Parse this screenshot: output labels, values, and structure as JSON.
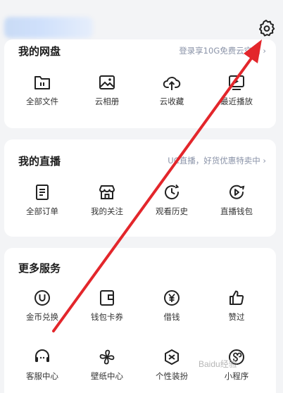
{
  "netdisk": {
    "title": "我的网盘",
    "hint": "登录享10G免费云空间 ›",
    "items": [
      {
        "label": "全部文件",
        "icon": "folder-icon"
      },
      {
        "label": "云相册",
        "icon": "photo-icon"
      },
      {
        "label": "云收藏",
        "icon": "cloud-upload-icon"
      },
      {
        "label": "最近播放",
        "icon": "tv-play-icon"
      }
    ]
  },
  "live": {
    "title": "我的直播",
    "hint": "UC直播，好货优惠特卖中 ›",
    "items": [
      {
        "label": "全部订单",
        "icon": "order-list-icon"
      },
      {
        "label": "我的关注",
        "icon": "store-icon"
      },
      {
        "label": "观看历史",
        "icon": "history-clock-icon"
      },
      {
        "label": "直播钱包",
        "icon": "wallet-play-icon"
      }
    ]
  },
  "services": {
    "title": "更多服务",
    "items": [
      {
        "label": "金币兑换",
        "icon": "coin-u-icon"
      },
      {
        "label": "钱包卡券",
        "icon": "card-wallet-icon"
      },
      {
        "label": "借钱",
        "icon": "yuan-icon"
      },
      {
        "label": "赞过",
        "icon": "thumbs-up-icon"
      },
      {
        "label": "客服中心",
        "icon": "headset-icon"
      },
      {
        "label": "壁纸中心",
        "icon": "pinwheel-icon"
      },
      {
        "label": "个性装扮",
        "icon": "style-icon"
      },
      {
        "label": "小程序",
        "icon": "mini-program-icon"
      }
    ]
  },
  "watermark": "Baidu经验",
  "colors": {
    "arrow": "#e3262b",
    "text": "#1c1c1c",
    "hint": "#8a93a8"
  }
}
